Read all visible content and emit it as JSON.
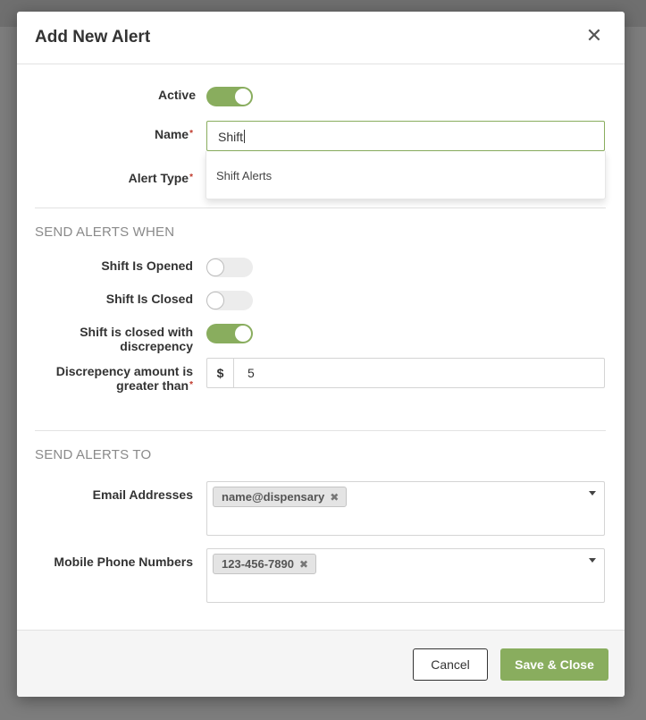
{
  "modal": {
    "title": "Add New Alert"
  },
  "form": {
    "active": {
      "label": "Active",
      "on": true
    },
    "name": {
      "label": "Name",
      "value": "Shift",
      "required": "*"
    },
    "name_suggestions": [
      "Shift Alerts"
    ],
    "alert_type": {
      "label": "Alert Type",
      "required": "*"
    }
  },
  "send_when": {
    "title": "SEND ALERTS WHEN",
    "shift_opened": {
      "label": "Shift Is Opened",
      "on": false
    },
    "shift_closed": {
      "label": "Shift Is Closed",
      "on": false
    },
    "shift_discrepency": {
      "label_line1": "Shift is closed with",
      "label_line2": "discrepency",
      "on": true
    },
    "discrepency_amount": {
      "label_line1": "Discrepency amount is",
      "label_line2": "greater than",
      "required": "*",
      "currency": "$",
      "value": "5"
    }
  },
  "send_to": {
    "title": "SEND ALERTS TO",
    "email": {
      "label": "Email Addresses",
      "tags": [
        "name@dispensary"
      ]
    },
    "phone": {
      "label": "Mobile Phone Numbers",
      "tags": [
        "123-456-7890"
      ]
    }
  },
  "footer": {
    "cancel_label": "Cancel",
    "save_label": "Save & Close"
  },
  "icons": {
    "close": "close-icon",
    "tag_remove": "tag-remove-icon",
    "select_arrow": "chevron-down-icon"
  },
  "colors": {
    "accent": "#89ad5e",
    "required": "#c0392b",
    "section_title": "#8a8a8a"
  }
}
